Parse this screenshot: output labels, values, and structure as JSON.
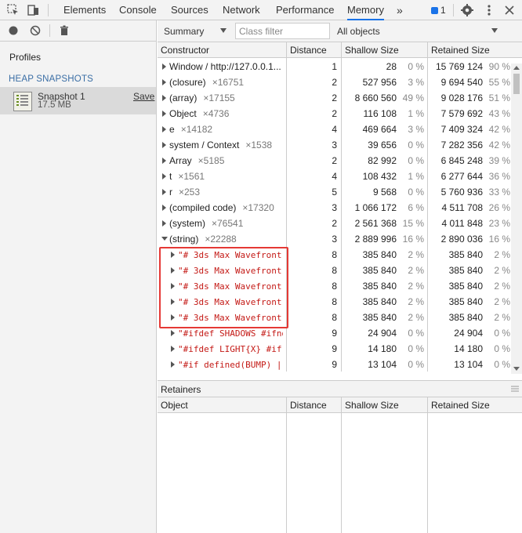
{
  "tabs": [
    "Elements",
    "Console",
    "Sources",
    "Network",
    "Performance",
    "Memory"
  ],
  "active_tab": "Memory",
  "more_tabs_label": "»",
  "message_count": "1",
  "left": {
    "profiles_title": "Profiles",
    "heap_title": "HEAP SNAPSHOTS",
    "snapshot_name": "Snapshot 1",
    "snapshot_size": "17.5 MB",
    "save_label": "Save"
  },
  "toolbar": {
    "view": "Summary",
    "filter_placeholder": "Class filter",
    "objects_filter": "All objects"
  },
  "columns": {
    "constructor": "Constructor",
    "distance": "Distance",
    "shallow": "Shallow Size",
    "retained": "Retained Size"
  },
  "rows": [
    {
      "name": "Window / http://127.0.0.1...",
      "count": "",
      "type": "plain",
      "distance": "1",
      "shallow": "28",
      "shallow_pct": "0 %",
      "retained": "15 769 124",
      "retained_pct": "90 %",
      "level": 0,
      "open": false
    },
    {
      "name": "(closure)",
      "count": "×16751",
      "type": "plain",
      "distance": "2",
      "shallow": "527 956",
      "shallow_pct": "3 %",
      "retained": "9 694 540",
      "retained_pct": "55 %",
      "level": 0,
      "open": false
    },
    {
      "name": "(array)",
      "count": "×17155",
      "type": "plain",
      "distance": "2",
      "shallow": "8 660 560",
      "shallow_pct": "49 %",
      "retained": "9 028 176",
      "retained_pct": "51 %",
      "level": 0,
      "open": false
    },
    {
      "name": "Object",
      "count": "×4736",
      "type": "plain",
      "distance": "2",
      "shallow": "116 108",
      "shallow_pct": "1 %",
      "retained": "7 579 692",
      "retained_pct": "43 %",
      "level": 0,
      "open": false
    },
    {
      "name": "e",
      "count": "×14182",
      "type": "plain",
      "distance": "4",
      "shallow": "469 664",
      "shallow_pct": "3 %",
      "retained": "7 409 324",
      "retained_pct": "42 %",
      "level": 0,
      "open": false
    },
    {
      "name": "system / Context",
      "count": "×1538",
      "type": "plain",
      "distance": "3",
      "shallow": "39 656",
      "shallow_pct": "0 %",
      "retained": "7 282 356",
      "retained_pct": "42 %",
      "level": 0,
      "open": false
    },
    {
      "name": "Array",
      "count": "×5185",
      "type": "plain",
      "distance": "2",
      "shallow": "82 992",
      "shallow_pct": "0 %",
      "retained": "6 845 248",
      "retained_pct": "39 %",
      "level": 0,
      "open": false
    },
    {
      "name": "t",
      "count": "×1561",
      "type": "plain",
      "distance": "4",
      "shallow": "108 432",
      "shallow_pct": "1 %",
      "retained": "6 277 644",
      "retained_pct": "36 %",
      "level": 0,
      "open": false
    },
    {
      "name": "r",
      "count": "×253",
      "type": "plain",
      "distance": "5",
      "shallow": "9 568",
      "shallow_pct": "0 %",
      "retained": "5 760 936",
      "retained_pct": "33 %",
      "level": 0,
      "open": false
    },
    {
      "name": "(compiled code)",
      "count": "×17320",
      "type": "plain",
      "distance": "3",
      "shallow": "1 066 172",
      "shallow_pct": "6 %",
      "retained": "4 511 708",
      "retained_pct": "26 %",
      "level": 0,
      "open": false
    },
    {
      "name": "(system)",
      "count": "×76541",
      "type": "plain",
      "distance": "2",
      "shallow": "2 561 368",
      "shallow_pct": "15 %",
      "retained": "4 011 848",
      "retained_pct": "23 %",
      "level": 0,
      "open": false
    },
    {
      "name": "(string)",
      "count": "×22288",
      "type": "plain",
      "distance": "3",
      "shallow": "2 889 996",
      "shallow_pct": "16 %",
      "retained": "2 890 036",
      "retained_pct": "16 %",
      "level": 0,
      "open": true
    },
    {
      "name": "\"# 3ds Max Wavefront",
      "count": "",
      "type": "str",
      "distance": "8",
      "shallow": "385 840",
      "shallow_pct": "2 %",
      "retained": "385 840",
      "retained_pct": "2 %",
      "level": 1,
      "open": false
    },
    {
      "name": "\"# 3ds Max Wavefront",
      "count": "",
      "type": "str",
      "distance": "8",
      "shallow": "385 840",
      "shallow_pct": "2 %",
      "retained": "385 840",
      "retained_pct": "2 %",
      "level": 1,
      "open": false
    },
    {
      "name": "\"# 3ds Max Wavefront",
      "count": "",
      "type": "str",
      "distance": "8",
      "shallow": "385 840",
      "shallow_pct": "2 %",
      "retained": "385 840",
      "retained_pct": "2 %",
      "level": 1,
      "open": false
    },
    {
      "name": "\"# 3ds Max Wavefront",
      "count": "",
      "type": "str",
      "distance": "8",
      "shallow": "385 840",
      "shallow_pct": "2 %",
      "retained": "385 840",
      "retained_pct": "2 %",
      "level": 1,
      "open": false
    },
    {
      "name": "\"# 3ds Max Wavefront",
      "count": "",
      "type": "str",
      "distance": "8",
      "shallow": "385 840",
      "shallow_pct": "2 %",
      "retained": "385 840",
      "retained_pct": "2 %",
      "level": 1,
      "open": false
    },
    {
      "name": "\"#ifdef SHADOWS #ifnd",
      "count": "",
      "type": "str",
      "distance": "9",
      "shallow": "24 904",
      "shallow_pct": "0 %",
      "retained": "24 904",
      "retained_pct": "0 %",
      "level": 1,
      "open": false
    },
    {
      "name": "\"#ifdef LIGHT{X} #if",
      "count": "",
      "type": "str",
      "distance": "9",
      "shallow": "14 180",
      "shallow_pct": "0 %",
      "retained": "14 180",
      "retained_pct": "0 %",
      "level": 1,
      "open": false
    },
    {
      "name": "\"#if defined(BUMP) ||",
      "count": "",
      "type": "str",
      "distance": "9",
      "shallow": "13 104",
      "shallow_pct": "0 %",
      "retained": "13 104",
      "retained_pct": "0 %",
      "level": 1,
      "open": false
    }
  ],
  "retainers": {
    "title": "Retainers",
    "columns": {
      "object": "Object",
      "distance": "Distance",
      "shallow": "Shallow Size",
      "retained": "Retained Size"
    }
  },
  "colors": {
    "accent": "#1a73e8",
    "highlight_border": "#e53935",
    "string_text": "#c41a16"
  }
}
